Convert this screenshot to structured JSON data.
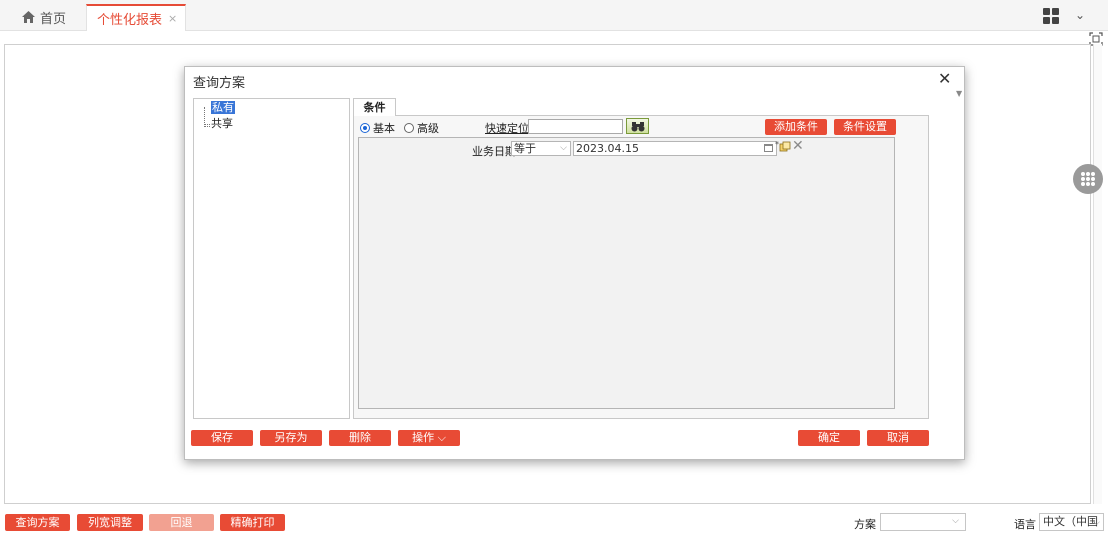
{
  "tabs": {
    "home_label": "首页",
    "report_label": "个性化报表",
    "close_glyph": "×"
  },
  "dialog": {
    "title": "查询方案",
    "close_glyph": "✕",
    "tree": {
      "private": "私有",
      "shared": "共享"
    },
    "condition_tab": "条件",
    "mode": {
      "basic": "基本",
      "advanced": "高级",
      "selected": "basic"
    },
    "quick_locate_label": "快速定位",
    "quick_locate_value": "",
    "add_condition": "添加条件",
    "condition_settings": "条件设置",
    "condition": {
      "field": "业务日期",
      "operator": "等于",
      "value": "2023.04.15",
      "star": "*"
    },
    "buttons": {
      "save": "保存",
      "save_as": "另存为",
      "delete": "删除",
      "operations": "操作",
      "ok": "确定",
      "cancel": "取消"
    }
  },
  "bottombar": {
    "query_scheme": "查询方案",
    "column_width": "列宽调整",
    "back": "回退",
    "precise_print": "精确打印",
    "scheme_label": "方案",
    "scheme_value": "",
    "language_label": "语言",
    "language_value": "中文（中国"
  },
  "colors": {
    "accent": "#e84b35",
    "accent_disabled": "#f2a191",
    "selection": "#3875d7"
  },
  "icons": {
    "home": "home-icon",
    "apps": "grid-icon",
    "fullscreen": "fullscreen-icon",
    "binoculars": "binoculars-icon",
    "calendar": "calendar-icon",
    "copy": "copy-condition-icon",
    "delete": "delete-condition-icon",
    "float_menu": "dots-menu-icon"
  }
}
